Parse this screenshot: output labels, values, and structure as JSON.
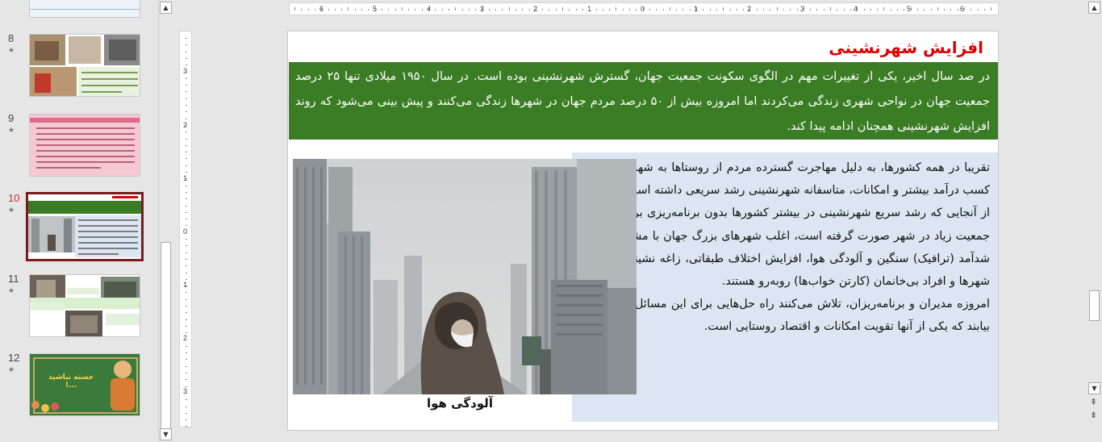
{
  "thumbnails": [
    {
      "number": "8",
      "star": "★"
    },
    {
      "number": "9",
      "star": "★"
    },
    {
      "number": "10",
      "star": "★"
    },
    {
      "number": "11",
      "star": "★"
    },
    {
      "number": "12",
      "star": "★"
    }
  ],
  "thumb12_text": "خسته نباشید ...!",
  "ruler_h": [
    "6",
    "5",
    "4",
    "3",
    "2",
    "1",
    "0",
    "1",
    "2",
    "3",
    "4",
    "5",
    "6"
  ],
  "ruler_v": [
    "3",
    "2",
    "1",
    "0",
    "1",
    "2",
    "3"
  ],
  "slide": {
    "title": "افزایش شهرنشینی",
    "intro": "در صد سال اخیر، یکی از تغییرات مهم در الگوی سکونت جمعیت جهان، گسترش شهرنشینی بوده است. در سال ۱۹۵۰ میلادی تنها ۲۵ درصد جمعیت جهان در نواحی شهری زندگی می‌کردند اما امروزه بیش از ۵۰ درصد مردم جهان در شهرها زندگی می‌کنند و پیش بینی می‌شود که روند افزایش شهرنشینی همچنان ادامه پیدا کند.",
    "paragraphs": [
      "تقریبا در همه کشورها، به دلیل مهاجرت گسترده مردم از روستاها به شهرها به دنبال کسب درآمد بیشتر و امکانات، متاسفانه شهرنشینی رشد سریعی داشته است.",
      "از آنجایی که رشد سریع شهرنشینی در بیشتر کشورها بدون برنامه‌ریزی برای سکونت جمعیت زیاد در شهر صورت گرفته است، اغلب شهرهای بزرگ جهان با مشکلاتی چون شدآمد (ترافیک) سنگین و آلودگی هوا، افزایش اختلاف طبقاتی، زاغه نشینی در حومه شهرها و افراد بی‌خانمان (کارتن خواب‌ها) روبه‌رو هستند.",
      "امروزه مدیران و برنامه‌ریزان، تلاش می‌کنند راه حل‌هایی برای این مسائل و مشکلات بیابند که یکی از آنها تقویت امکانات و اقتصاد روستایی است."
    ],
    "photo_caption": "آلودگی هوا"
  },
  "colors": {
    "green_box": "#3a7d24",
    "blue_box": "#dce6f2",
    "title_red": "#e00000",
    "active_border": "#7b1b1b"
  },
  "icons": {
    "scroll_up": "▲",
    "scroll_down": "▼",
    "prev_slide": "⇞",
    "next_slide": "⇟"
  }
}
